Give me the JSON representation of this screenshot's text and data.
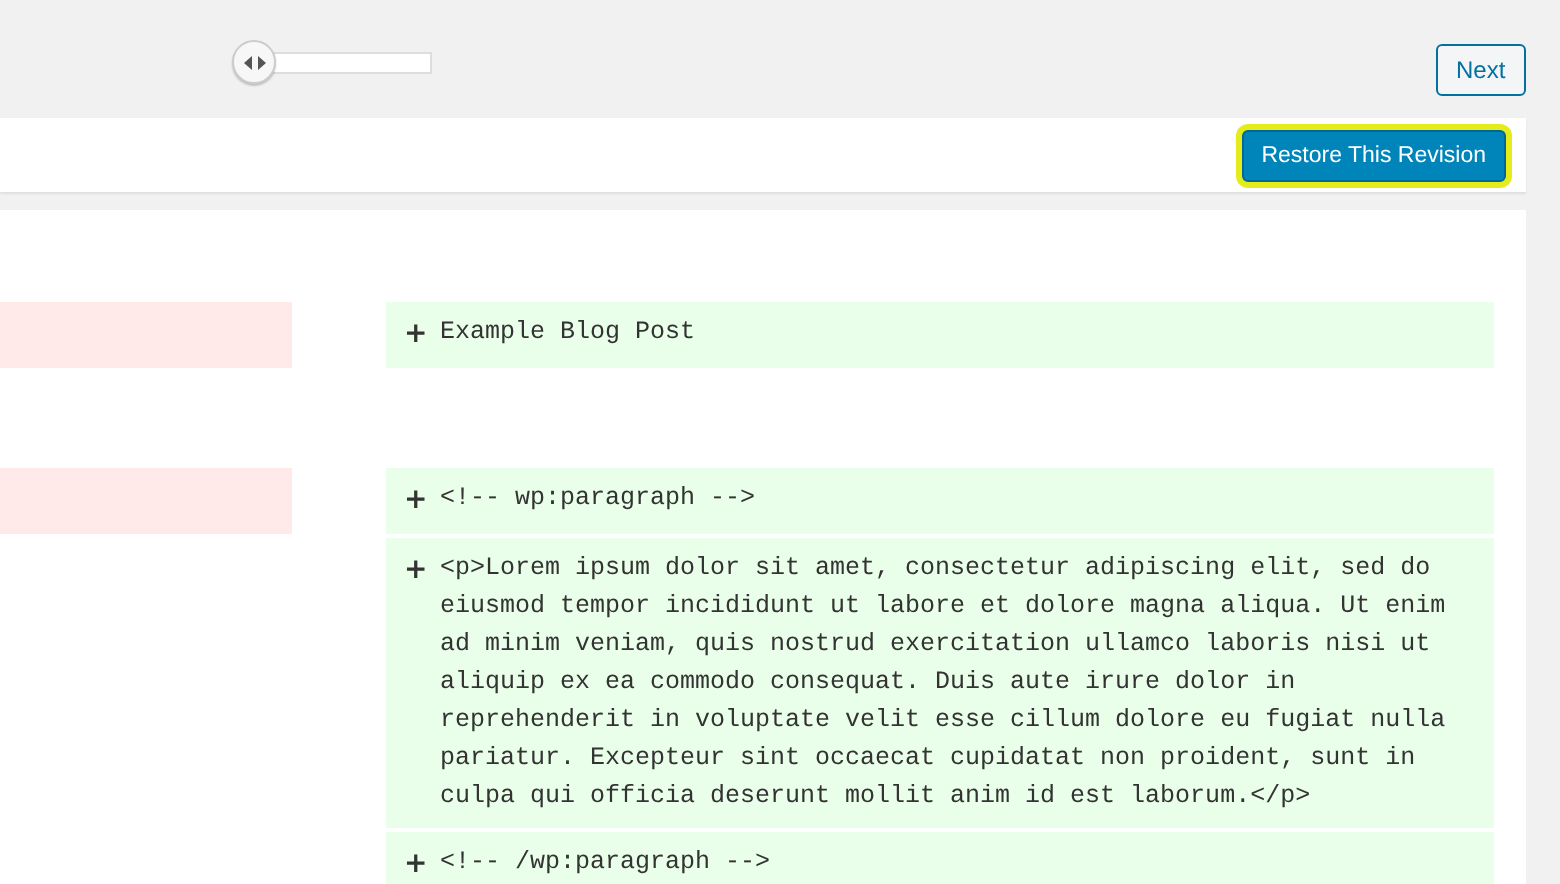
{
  "slider": {
    "level": 0
  },
  "next_button": {
    "label": "Next"
  },
  "restore_button": {
    "label": "Restore This Revision",
    "focused": true
  },
  "diff_rows": [
    {
      "left_removed": true,
      "marker": "+",
      "text": "Example Blog Post",
      "gap_before": true
    },
    {
      "left_removed": true,
      "marker": "+",
      "text": "<!-- wp:paragraph -->",
      "gap_before": true
    },
    {
      "left_removed": false,
      "marker": "+",
      "text": "<p>Lorem ipsum dolor sit amet, consectetur adipiscing elit, sed do eiusmod tempor incididunt ut labore et dolore magna aliqua. Ut enim ad minim veniam, quis nostrud exercitation ullamco laboris nisi ut aliquip ex ea commodo consequat. Duis aute irure dolor in reprehenderit in voluptate velit esse cillum dolore eu fugiat nulla pariatur. Excepteur sint occaecat cupidatat non proident, sunt in culpa qui officia deserunt mollit anim id est laborum.</p>",
      "gap_before": false
    },
    {
      "left_removed": false,
      "marker": "+",
      "text": "<!-- /wp:paragraph -->",
      "gap_before": false
    }
  ]
}
